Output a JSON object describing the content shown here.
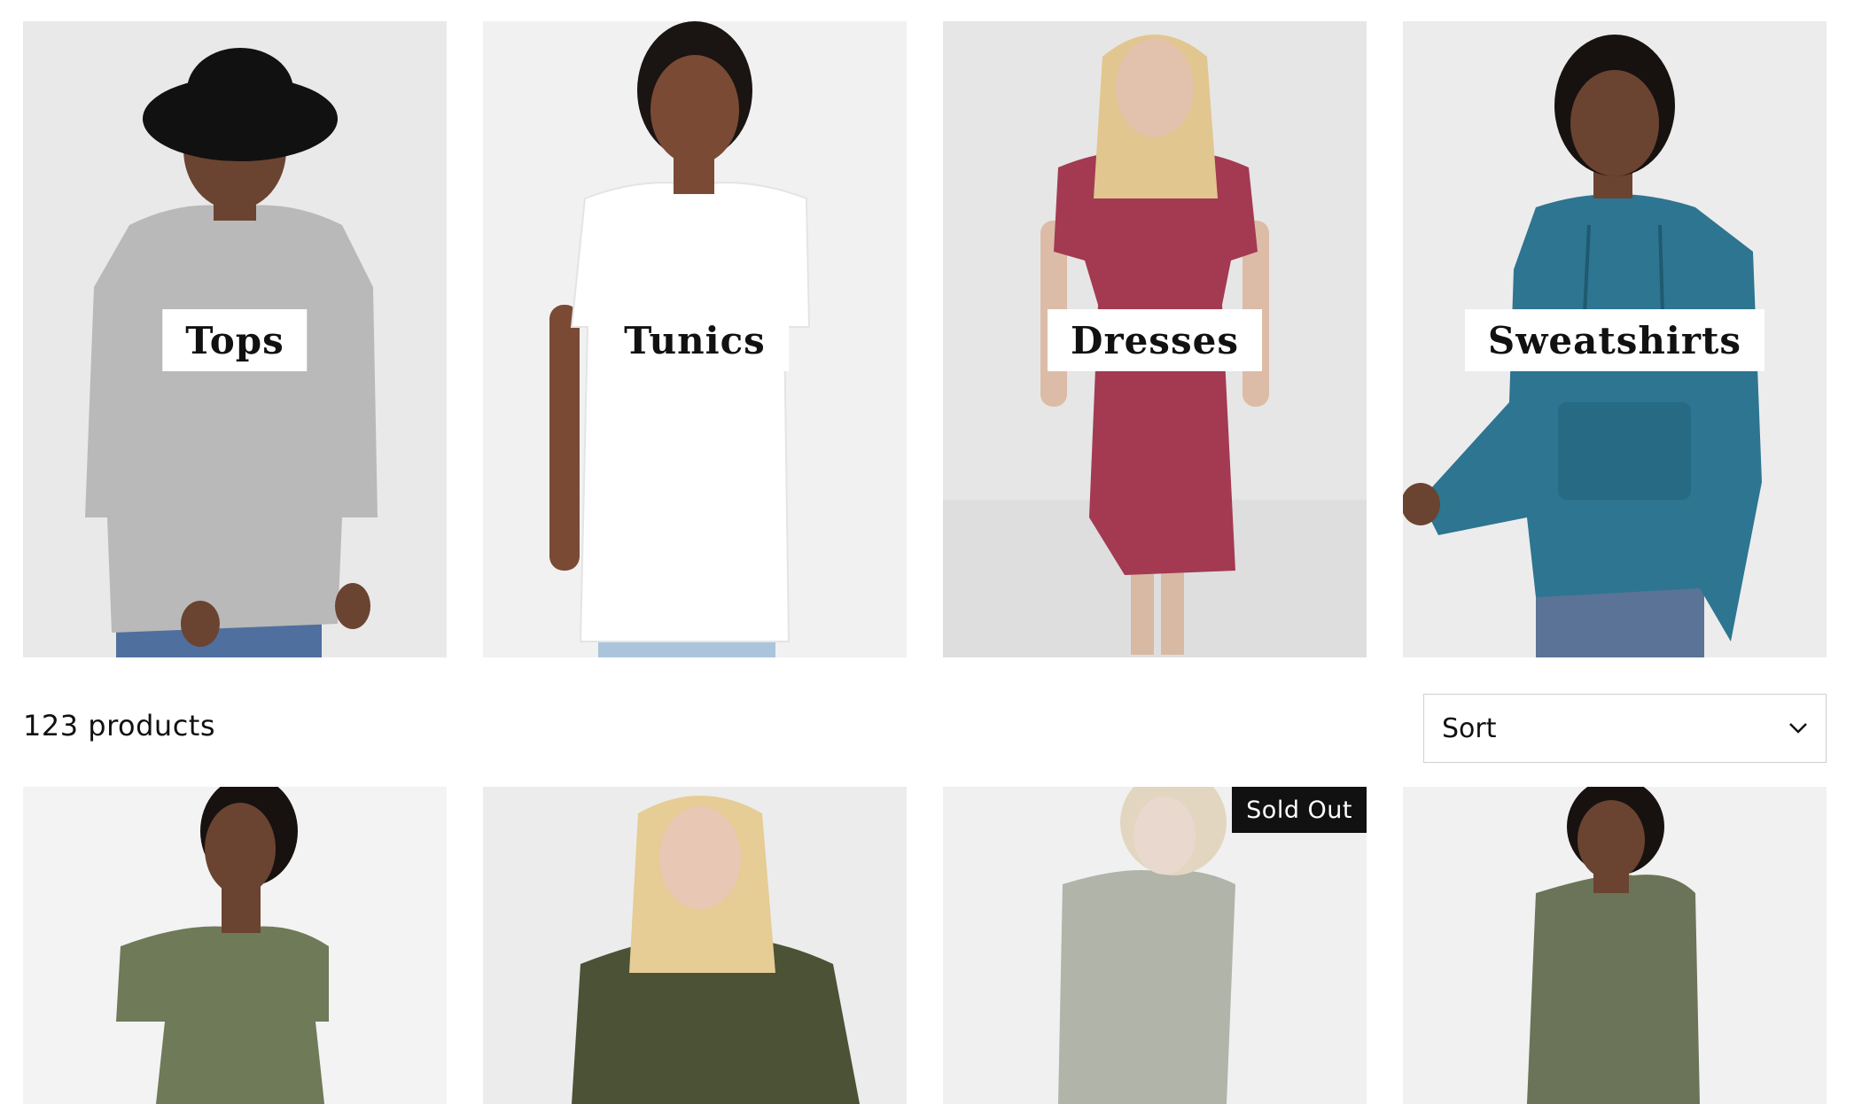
{
  "categories": [
    {
      "label": "Tops"
    },
    {
      "label": "Tunics"
    },
    {
      "label": "Dresses"
    },
    {
      "label": "Sweatshirts"
    }
  ],
  "toolbar": {
    "product_count": "123 products",
    "sort_label": "Sort",
    "sort_icon": "chevron-down-icon"
  },
  "products": [
    {
      "color": "#6e7a58",
      "sold_out": false
    },
    {
      "color": "#4b5236",
      "sold_out": false
    },
    {
      "color": "#7d8471",
      "sold_out": true,
      "badge": "Sold Out"
    },
    {
      "color": "#6b7458",
      "sold_out": false
    }
  ],
  "colors": {
    "tile_bg": "#ececec",
    "label_bg": "#ffffff",
    "badge_bg": "#111111",
    "tops_shirt": "#b9b9b9",
    "tunic_shirt": "#ffffff",
    "dress": "#a33a52",
    "sweatshirt": "#2d7591",
    "jeans": "#4f6f9e"
  }
}
